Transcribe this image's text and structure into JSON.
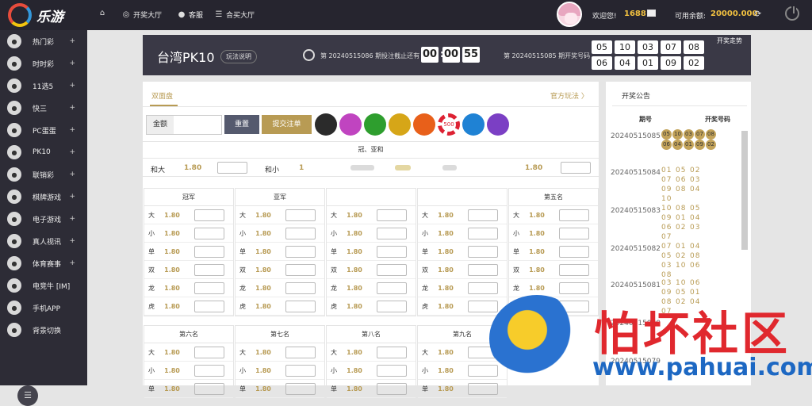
{
  "topbar": {
    "logo_text": "乐游",
    "nav": [
      {
        "label": "",
        "icon": "home-icon"
      },
      {
        "label": "开奖大厅",
        "icon": "lottery-icon"
      },
      {
        "label": "客服",
        "icon": "chat-icon"
      },
      {
        "label": "合买大厅",
        "icon": "list-icon"
      }
    ],
    "welcome": "欢迎您!",
    "points": "1688",
    "balance_label": "可用余额:",
    "balance_value": "20000.000"
  },
  "sidebar": {
    "items": [
      {
        "label": "热门彩",
        "icon": "hot-icon",
        "plus": "+"
      },
      {
        "label": "时时彩",
        "icon": "ssc-icon",
        "plus": "+"
      },
      {
        "label": "11选5",
        "icon": "11x5-icon",
        "plus": "+"
      },
      {
        "label": "快三",
        "icon": "k3-icon",
        "plus": "+"
      },
      {
        "label": "PC蛋蛋",
        "icon": "pc-icon",
        "plus": "+"
      },
      {
        "label": "PK10",
        "icon": "pk10-icon",
        "plus": "+"
      },
      {
        "label": "联销彩",
        "icon": "link-icon",
        "plus": "+"
      },
      {
        "label": "棋牌游戏",
        "icon": "cards-icon",
        "plus": "+"
      },
      {
        "label": "电子游戏",
        "icon": "slot-icon",
        "plus": "+"
      },
      {
        "label": "真人视讯",
        "icon": "live-icon",
        "plus": "+"
      },
      {
        "label": "体育赛事",
        "icon": "sport-icon",
        "plus": "+"
      },
      {
        "label": "电竞牛 [IM]",
        "icon": "esport-icon",
        "plus": ""
      },
      {
        "label": "手机APP",
        "icon": "phone-icon",
        "plus": ""
      },
      {
        "label": "背景切换",
        "icon": "monitor-icon",
        "plus": ""
      }
    ]
  },
  "header": {
    "game_name": "台湾PK10",
    "rules": "玩法说明",
    "issue_text": "第  20240515086  期投注截止还有",
    "timer": [
      "00",
      "00",
      "55"
    ],
    "last_text": "第  20240515085  期开奖号码",
    "numbers": [
      "05",
      "10",
      "03",
      "07",
      "08",
      "06",
      "04",
      "01",
      "09",
      "02"
    ],
    "trend": "开奖走势"
  },
  "main": {
    "tab": "双面盘",
    "official": "官方玩法  〉",
    "amount_label": "金额",
    "reset": "重置",
    "submit": "提交注单",
    "chips": [
      {
        "color": "#2b2b2b"
      },
      {
        "color": "#c044c0"
      },
      {
        "color": "#2e9e2e"
      },
      {
        "color": "#d6a618"
      },
      {
        "color": "#e8601a"
      },
      {
        "label": "500",
        "color": "#d23"
      },
      {
        "color": "#1f82d4"
      },
      {
        "color": "#7b3fc4"
      }
    ],
    "sum_title": "冠、亚和",
    "sum_row": [
      {
        "key": "和大",
        "odds": "1.80"
      },
      {
        "key": "和小",
        "odds": "1"
      },
      {
        "key": "",
        "odds": "1.80"
      }
    ],
    "blocks_top": [
      {
        "title": "冠军"
      },
      {
        "title": "亚军"
      },
      {
        "title": ""
      },
      {
        "title": ""
      },
      {
        "title": "第五名"
      }
    ],
    "blocks_bottom": [
      {
        "title": "第六名"
      },
      {
        "title": "第七名"
      },
      {
        "title": "第八名"
      },
      {
        "title": "第九名"
      }
    ],
    "row_keys": [
      "大",
      "小",
      "单",
      "双",
      "龙",
      "虎"
    ],
    "odds": "1.80"
  },
  "panel": {
    "title": "开奖公告",
    "col1": "期号",
    "col2": "开奖号码",
    "rows": [
      {
        "issue": "20240515085",
        "nums": [
          "05",
          "10",
          "03",
          "07",
          "08",
          "06",
          "04",
          "01",
          "09",
          "02"
        ]
      },
      {
        "issue": "20240515084",
        "nums": [
          "01",
          "05",
          "02",
          "07",
          "06",
          "03",
          "09",
          "08",
          "04",
          "10"
        ]
      },
      {
        "issue": "20240515083",
        "nums": [
          "10",
          "08",
          "05",
          "09",
          "01",
          "04",
          "06",
          "02",
          "03",
          "07"
        ]
      },
      {
        "issue": "20240515082",
        "nums": [
          "07",
          "01",
          "04",
          "05",
          "02",
          "08",
          "03",
          "10",
          "06",
          "08"
        ]
      },
      {
        "issue": "20240515081",
        "nums": [
          "03",
          "10",
          "06",
          "09",
          "05",
          "01",
          "08",
          "02",
          "04",
          "07"
        ]
      },
      {
        "issue": "20240515080",
        "nums": []
      },
      {
        "issue": "20240515079",
        "nums": []
      }
    ]
  },
  "watermark": {
    "title": "怕坏社区",
    "url": "www.pahuai.com"
  }
}
